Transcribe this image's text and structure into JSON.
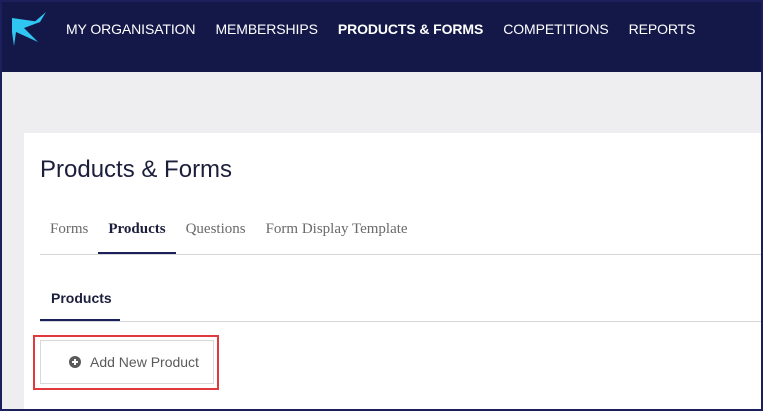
{
  "nav": {
    "items": [
      {
        "label": "MY ORGANISATION",
        "active": false
      },
      {
        "label": "MEMBERSHIPS",
        "active": false
      },
      {
        "label": "PRODUCTS & FORMS",
        "active": true
      },
      {
        "label": "COMPETITIONS",
        "active": false
      },
      {
        "label": "REPORTS",
        "active": false
      }
    ],
    "logo_icon": "star-bolt-logo",
    "colors": {
      "background": "#141849",
      "logo": "#2fc6f2"
    }
  },
  "page": {
    "title": "Products & Forms"
  },
  "tabs": [
    {
      "label": "Forms",
      "active": false
    },
    {
      "label": "Products",
      "active": true
    },
    {
      "label": "Questions",
      "active": false
    },
    {
      "label": "Form Display Template",
      "active": false
    }
  ],
  "subtabs": [
    {
      "label": "Products",
      "active": true
    }
  ],
  "actions": {
    "add_button_label": "Add New Product",
    "add_button_icon": "plus-circle-icon",
    "highlight_color": "#e0393e"
  }
}
